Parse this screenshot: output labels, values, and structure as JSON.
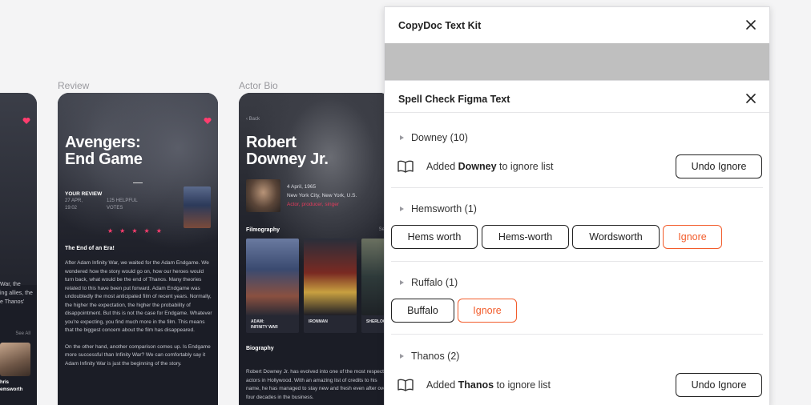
{
  "canvas": {
    "review_label": "Review",
    "bio_label": "Actor Bio",
    "left_frame": {
      "text_lines": [
        "War, the",
        "ing allies, the",
        "e Thanos'"
      ],
      "see_all": "See All",
      "name_line1": "hris",
      "name_line2": "emsworth"
    },
    "review": {
      "title_line1": "Avengers:",
      "title_line2": "End Game",
      "your_review": "YOUR REVIEW",
      "date_line1": "27 APR,",
      "date_line2": "19:02",
      "helpful_line1": "125 HELPFUL",
      "helpful_line2": "VOTES",
      "stars": "★★★★★",
      "heading": "The End of an Era!",
      "para1": "After Adam Infinity War, we waited for the Adam Endgame. We wondered how the story would go on, how our heroes would turn back, what would be the end of Thanos. Many theories related to this have been put forward. Adam Endgame was undoubtedly the most anticipated film of recent years. Normally, the higher the expectation, the higher the probability of disappointment. But this is not the case for Endgame. Whatever you're expecting, you find much more in the film. This means that the biggest concern about the film has disappeared.",
      "para2": "On the other hand, another comparison comes up. Is Endgame more successful than Infinity War? We can comfortably say it Adam Infinity War is just the beginning of the story."
    },
    "bio": {
      "back": "‹ Back",
      "title_line1": "Robert",
      "title_line2": "Downey Jr.",
      "birth_date": "4 April, 1965",
      "birth_place": "New York City, New York, U.S.",
      "roles": "Actor, producer, singer",
      "filmography": "Filmography",
      "see": "Se",
      "films": [
        {
          "caption_line1": "ADAM:",
          "caption_line2": "INFINITY WAR"
        },
        {
          "caption_line1": "IRONMAN",
          "caption_line2": ""
        },
        {
          "caption_line1": "SHERLOC",
          "caption_line2": ""
        }
      ],
      "biography": "Biography",
      "bio_text": "Robert Downey Jr. has evolved into one of the most respected actors in Hollywood. With an amazing list of credits to his name, he has managed to stay new and fresh even after over four decades in the business."
    }
  },
  "kit_panel": {
    "title": "CopyDoc Text Kit"
  },
  "spell_panel": {
    "title": "Spell Check Figma Text",
    "sections": [
      {
        "word": "Downey (10)",
        "added_prefix": "Added ",
        "added_word": "Downey",
        "added_suffix": " to ignore list",
        "undo_label": "Undo Ignore"
      },
      {
        "word": "Hemsworth (1)",
        "suggestions": [
          "Hems worth",
          "Hems-worth",
          "Wordsworth"
        ],
        "ignore_label": "Ignore"
      },
      {
        "word": "Ruffalo (1)",
        "suggestions": [
          "Buffalo"
        ],
        "ignore_label": "Ignore"
      },
      {
        "word": "Thanos (2)",
        "added_prefix": "Added ",
        "added_word": "Thanos",
        "added_suffix": " to ignore list",
        "undo_label": "Undo Ignore"
      }
    ]
  },
  "colors": {
    "ignore_accent": "#f25c2b",
    "heart": "#ff3d6e",
    "app_dark": "#1b1d26"
  }
}
